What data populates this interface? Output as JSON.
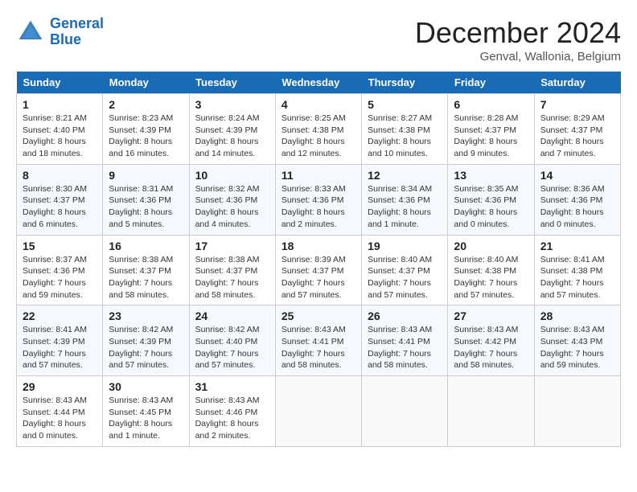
{
  "header": {
    "logo_line1": "General",
    "logo_line2": "Blue",
    "title": "December 2024",
    "subtitle": "Genval, Wallonia, Belgium"
  },
  "weekdays": [
    "Sunday",
    "Monday",
    "Tuesday",
    "Wednesday",
    "Thursday",
    "Friday",
    "Saturday"
  ],
  "weeks": [
    [
      {
        "day": "1",
        "sunrise": "Sunrise: 8:21 AM",
        "sunset": "Sunset: 4:40 PM",
        "daylight": "Daylight: 8 hours and 18 minutes."
      },
      {
        "day": "2",
        "sunrise": "Sunrise: 8:23 AM",
        "sunset": "Sunset: 4:39 PM",
        "daylight": "Daylight: 8 hours and 16 minutes."
      },
      {
        "day": "3",
        "sunrise": "Sunrise: 8:24 AM",
        "sunset": "Sunset: 4:39 PM",
        "daylight": "Daylight: 8 hours and 14 minutes."
      },
      {
        "day": "4",
        "sunrise": "Sunrise: 8:25 AM",
        "sunset": "Sunset: 4:38 PM",
        "daylight": "Daylight: 8 hours and 12 minutes."
      },
      {
        "day": "5",
        "sunrise": "Sunrise: 8:27 AM",
        "sunset": "Sunset: 4:38 PM",
        "daylight": "Daylight: 8 hours and 10 minutes."
      },
      {
        "day": "6",
        "sunrise": "Sunrise: 8:28 AM",
        "sunset": "Sunset: 4:37 PM",
        "daylight": "Daylight: 8 hours and 9 minutes."
      },
      {
        "day": "7",
        "sunrise": "Sunrise: 8:29 AM",
        "sunset": "Sunset: 4:37 PM",
        "daylight": "Daylight: 8 hours and 7 minutes."
      }
    ],
    [
      {
        "day": "8",
        "sunrise": "Sunrise: 8:30 AM",
        "sunset": "Sunset: 4:37 PM",
        "daylight": "Daylight: 8 hours and 6 minutes."
      },
      {
        "day": "9",
        "sunrise": "Sunrise: 8:31 AM",
        "sunset": "Sunset: 4:36 PM",
        "daylight": "Daylight: 8 hours and 5 minutes."
      },
      {
        "day": "10",
        "sunrise": "Sunrise: 8:32 AM",
        "sunset": "Sunset: 4:36 PM",
        "daylight": "Daylight: 8 hours and 4 minutes."
      },
      {
        "day": "11",
        "sunrise": "Sunrise: 8:33 AM",
        "sunset": "Sunset: 4:36 PM",
        "daylight": "Daylight: 8 hours and 2 minutes."
      },
      {
        "day": "12",
        "sunrise": "Sunrise: 8:34 AM",
        "sunset": "Sunset: 4:36 PM",
        "daylight": "Daylight: 8 hours and 1 minute."
      },
      {
        "day": "13",
        "sunrise": "Sunrise: 8:35 AM",
        "sunset": "Sunset: 4:36 PM",
        "daylight": "Daylight: 8 hours and 0 minutes."
      },
      {
        "day": "14",
        "sunrise": "Sunrise: 8:36 AM",
        "sunset": "Sunset: 4:36 PM",
        "daylight": "Daylight: 8 hours and 0 minutes."
      }
    ],
    [
      {
        "day": "15",
        "sunrise": "Sunrise: 8:37 AM",
        "sunset": "Sunset: 4:36 PM",
        "daylight": "Daylight: 7 hours and 59 minutes."
      },
      {
        "day": "16",
        "sunrise": "Sunrise: 8:38 AM",
        "sunset": "Sunset: 4:37 PM",
        "daylight": "Daylight: 7 hours and 58 minutes."
      },
      {
        "day": "17",
        "sunrise": "Sunrise: 8:38 AM",
        "sunset": "Sunset: 4:37 PM",
        "daylight": "Daylight: 7 hours and 58 minutes."
      },
      {
        "day": "18",
        "sunrise": "Sunrise: 8:39 AM",
        "sunset": "Sunset: 4:37 PM",
        "daylight": "Daylight: 7 hours and 57 minutes."
      },
      {
        "day": "19",
        "sunrise": "Sunrise: 8:40 AM",
        "sunset": "Sunset: 4:37 PM",
        "daylight": "Daylight: 7 hours and 57 minutes."
      },
      {
        "day": "20",
        "sunrise": "Sunrise: 8:40 AM",
        "sunset": "Sunset: 4:38 PM",
        "daylight": "Daylight: 7 hours and 57 minutes."
      },
      {
        "day": "21",
        "sunrise": "Sunrise: 8:41 AM",
        "sunset": "Sunset: 4:38 PM",
        "daylight": "Daylight: 7 hours and 57 minutes."
      }
    ],
    [
      {
        "day": "22",
        "sunrise": "Sunrise: 8:41 AM",
        "sunset": "Sunset: 4:39 PM",
        "daylight": "Daylight: 7 hours and 57 minutes."
      },
      {
        "day": "23",
        "sunrise": "Sunrise: 8:42 AM",
        "sunset": "Sunset: 4:39 PM",
        "daylight": "Daylight: 7 hours and 57 minutes."
      },
      {
        "day": "24",
        "sunrise": "Sunrise: 8:42 AM",
        "sunset": "Sunset: 4:40 PM",
        "daylight": "Daylight: 7 hours and 57 minutes."
      },
      {
        "day": "25",
        "sunrise": "Sunrise: 8:43 AM",
        "sunset": "Sunset: 4:41 PM",
        "daylight": "Daylight: 7 hours and 58 minutes."
      },
      {
        "day": "26",
        "sunrise": "Sunrise: 8:43 AM",
        "sunset": "Sunset: 4:41 PM",
        "daylight": "Daylight: 7 hours and 58 minutes."
      },
      {
        "day": "27",
        "sunrise": "Sunrise: 8:43 AM",
        "sunset": "Sunset: 4:42 PM",
        "daylight": "Daylight: 7 hours and 58 minutes."
      },
      {
        "day": "28",
        "sunrise": "Sunrise: 8:43 AM",
        "sunset": "Sunset: 4:43 PM",
        "daylight": "Daylight: 7 hours and 59 minutes."
      }
    ],
    [
      {
        "day": "29",
        "sunrise": "Sunrise: 8:43 AM",
        "sunset": "Sunset: 4:44 PM",
        "daylight": "Daylight: 8 hours and 0 minutes."
      },
      {
        "day": "30",
        "sunrise": "Sunrise: 8:43 AM",
        "sunset": "Sunset: 4:45 PM",
        "daylight": "Daylight: 8 hours and 1 minute."
      },
      {
        "day": "31",
        "sunrise": "Sunrise: 8:43 AM",
        "sunset": "Sunset: 4:46 PM",
        "daylight": "Daylight: 8 hours and 2 minutes."
      },
      null,
      null,
      null,
      null
    ]
  ]
}
